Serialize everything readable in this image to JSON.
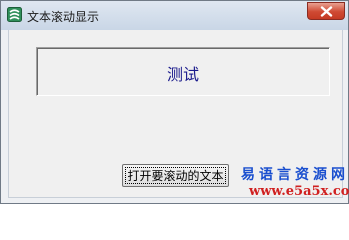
{
  "window": {
    "title": "文本滚动显示",
    "icon": "app-logo-icon",
    "close_icon": "close-icon"
  },
  "panel": {
    "text": "测试"
  },
  "buttons": {
    "open_label": "打开要滚动的文本"
  },
  "watermark": {
    "line1": "易语言资源网",
    "line2": "www.e5a5x.com"
  },
  "colors": {
    "title_gradient_top": "#dfe7f1",
    "close_red": "#cf4a33",
    "panel_text": "#1a1a8c",
    "watermark_blue": "#1a4fcf",
    "watermark_red": "#d02020"
  }
}
